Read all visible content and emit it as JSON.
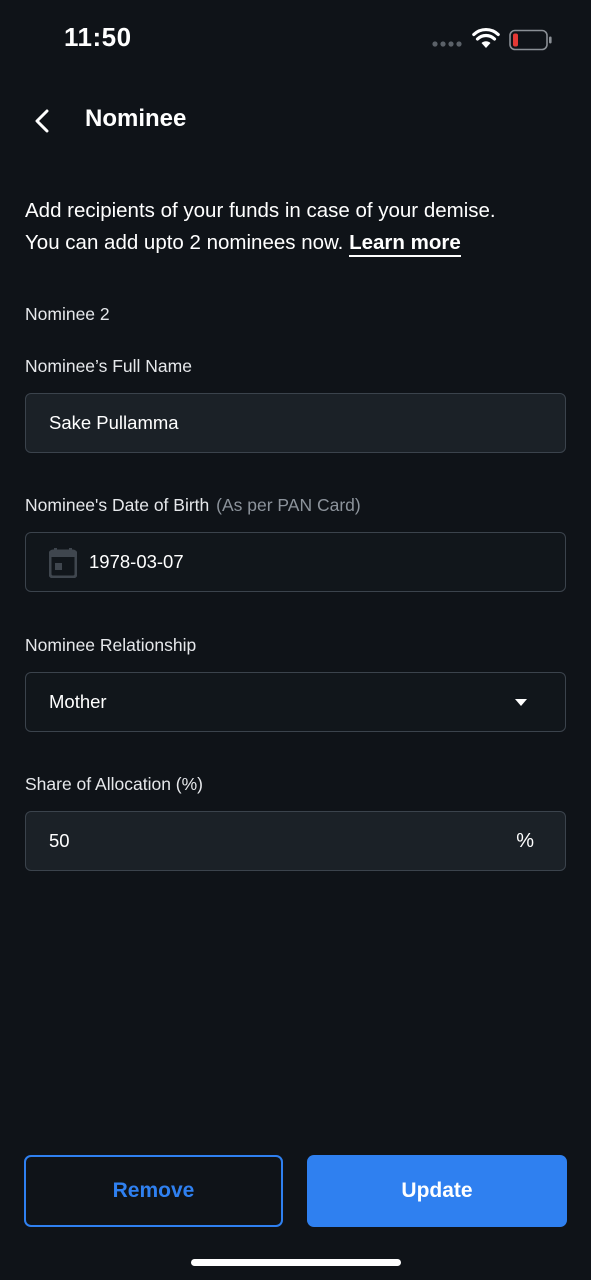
{
  "status_bar": {
    "time": "11:50"
  },
  "header": {
    "title": "Nominee"
  },
  "intro": {
    "line1": "Add recipients of your funds in case of your demise.",
    "line2": "You can add upto 2 nominees now.",
    "learn_more": "Learn more"
  },
  "section": {
    "label": "Nominee 2"
  },
  "fields": {
    "full_name": {
      "label": "Nominee’s Full Name",
      "value": "Sake Pullamma"
    },
    "dob": {
      "label": "Nominee's Date of Birth",
      "hint": "(As per PAN Card)",
      "value": "1978-03-07"
    },
    "relationship": {
      "label": "Nominee Relationship",
      "value": "Mother"
    },
    "allocation": {
      "label": "Share of Allocation (%)",
      "value": "50",
      "suffix": "%"
    }
  },
  "buttons": {
    "remove": "Remove",
    "update": "Update"
  },
  "colors": {
    "background": "#0f1318",
    "accent": "#2f80f0",
    "battery_low": "#e53935"
  },
  "icons": {
    "back": "chevron-left-icon",
    "calendar": "calendar-icon",
    "dropdown": "caret-down-icon",
    "wifi": "wifi-icon",
    "battery": "battery-icon",
    "signal": "signal-icon"
  }
}
